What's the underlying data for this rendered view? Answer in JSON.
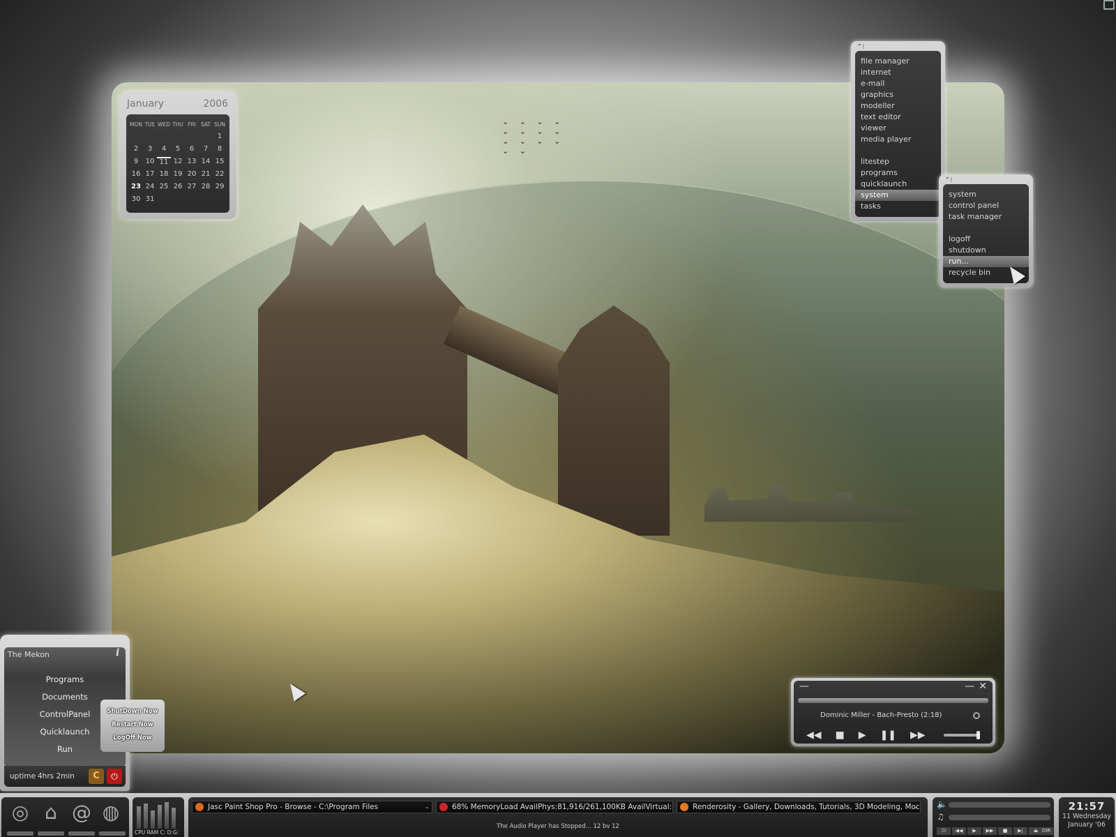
{
  "calendar": {
    "month": "January",
    "year": "2006",
    "weekdays": [
      "MON",
      "TUE",
      "WED",
      "THU",
      "FRI",
      "SAT",
      "SUN"
    ],
    "weeks": [
      [
        "",
        "",
        "",
        "",
        "",
        "",
        "1"
      ],
      [
        "2",
        "3",
        "4",
        "5",
        "6",
        "7",
        "8"
      ],
      [
        "9",
        "10",
        "11",
        "12",
        "13",
        "14",
        "15"
      ],
      [
        "16",
        "17",
        "18",
        "19",
        "20",
        "21",
        "22"
      ],
      [
        "23",
        "24",
        "25",
        "26",
        "27",
        "28",
        "29"
      ],
      [
        "30",
        "31",
        "",
        "",
        "",
        "",
        ""
      ]
    ],
    "marked_today": "11",
    "highlighted": "23"
  },
  "main_menu": {
    "items": [
      "file manager",
      "internet",
      "e-mail",
      "graphics",
      "modeller",
      "text editor",
      "viewer",
      "media player",
      "",
      "litestep",
      "programs",
      "quicklaunch",
      "system",
      "tasks"
    ],
    "selected": "system"
  },
  "system_menu": {
    "items": [
      "system",
      "control panel",
      "task manager",
      "",
      "logoff",
      "shutdown",
      "run...",
      "recycle bin"
    ],
    "selected": "run..."
  },
  "media_player": {
    "track": "Dominic Miller - Bach-Presto (2:18)",
    "controls": [
      "◀◀",
      "■",
      "▶",
      "❚❚",
      "▶▶"
    ]
  },
  "start_panel": {
    "title": "The Mekon",
    "info_icon": "i",
    "items": [
      "Programs",
      "Documents",
      "ControlPanel",
      "Quicklaunch",
      "Run"
    ],
    "uptime_label": "uptime",
    "uptime_value": "4hrs 2min"
  },
  "shutdown_popup": {
    "items": [
      "ShutDown Now",
      "Restart Now",
      "LogOff Now"
    ]
  },
  "taskbar": {
    "quick_icons": [
      "swirl-icon",
      "home-icon",
      "at-icon",
      "globe-icon"
    ],
    "sys_label": "CPU RAM C: D:G:",
    "tasks": [
      {
        "label": "Jasc Paint Shop Pro - Browse - C:\\Program Files",
        "color": "#d86a1a"
      },
      {
        "label": "68% MemoryLoad  AvailPhys:81,916/261,100KB AvailVirtual:1,9",
        "color": "#c8282a"
      },
      {
        "label": "Renderosity - Gallery, Downloads, Tutorials, 3D Modeling, Moc",
        "color": "#e07a20"
      }
    ],
    "status": "The Audio Player has Stopped... 12 bv 12",
    "audio_buttons": [
      "⏻",
      "◀◀",
      "▶",
      "▶▶",
      "■",
      "▶|",
      "⏏",
      "DIR"
    ],
    "clock_time": "21:57",
    "clock_day": "11 Wednesday",
    "clock_month": "January '06"
  }
}
